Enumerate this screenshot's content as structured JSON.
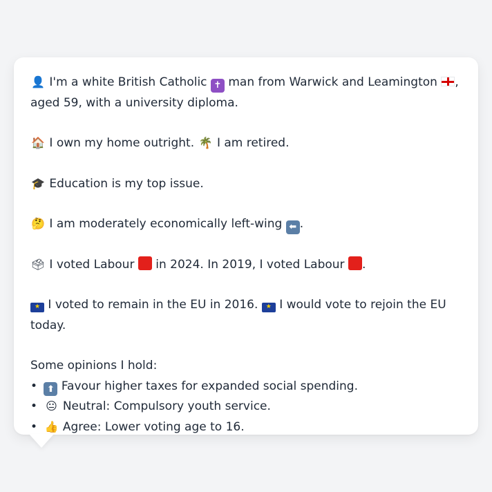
{
  "profile": {
    "line1_a": "I'm a white British Catholic",
    "line1_b": "man from Warwick and Leamington",
    "line1_c": ",",
    "line1_d": "aged 59, with a university diploma.",
    "home_a": "I own my home outright.",
    "home_b": "I am retired.",
    "education": "Education is my top issue.",
    "economics_a": "I am moderately economically left-wing",
    "economics_b": ".",
    "vote_a": "I voted Labour",
    "vote_b": "in 2024. In 2019, I voted Labour",
    "vote_c": ".",
    "eu_a": "I voted to remain in the EU in 2016.",
    "eu_b": "I would vote to rejoin the EU today."
  },
  "opinions": {
    "heading": "Some opinions I hold:",
    "bullet": "•",
    "items": [
      {
        "text": "Favour higher taxes for expanded social spending.",
        "icon": "up-arrow-icon"
      },
      {
        "text": "Neutral: Compulsory youth service.",
        "icon": "neutral-face-icon"
      },
      {
        "text": "Agree: Lower voting age to 16.",
        "icon": "thumbs-up-icon"
      }
    ]
  },
  "icons": {
    "person": "👤",
    "cross": "✝",
    "house": "🏠",
    "palm": "🌴",
    "grad_cap": "🎓",
    "thinking": "🤔",
    "left_arrow": "⬅",
    "ballot": "🗳",
    "eu_star": "★",
    "up_arrow": "⬆",
    "neutral_face": "😐",
    "thumbs_up": "👍"
  },
  "colors": {
    "background": "#f3f4f6",
    "card": "#ffffff",
    "text": "#1f2937",
    "labour_red": "#e3201b",
    "cross_purple": "#8e4fc4",
    "arrow_blue": "#5b7fa6",
    "eu_blue": "#1d3f9a"
  }
}
